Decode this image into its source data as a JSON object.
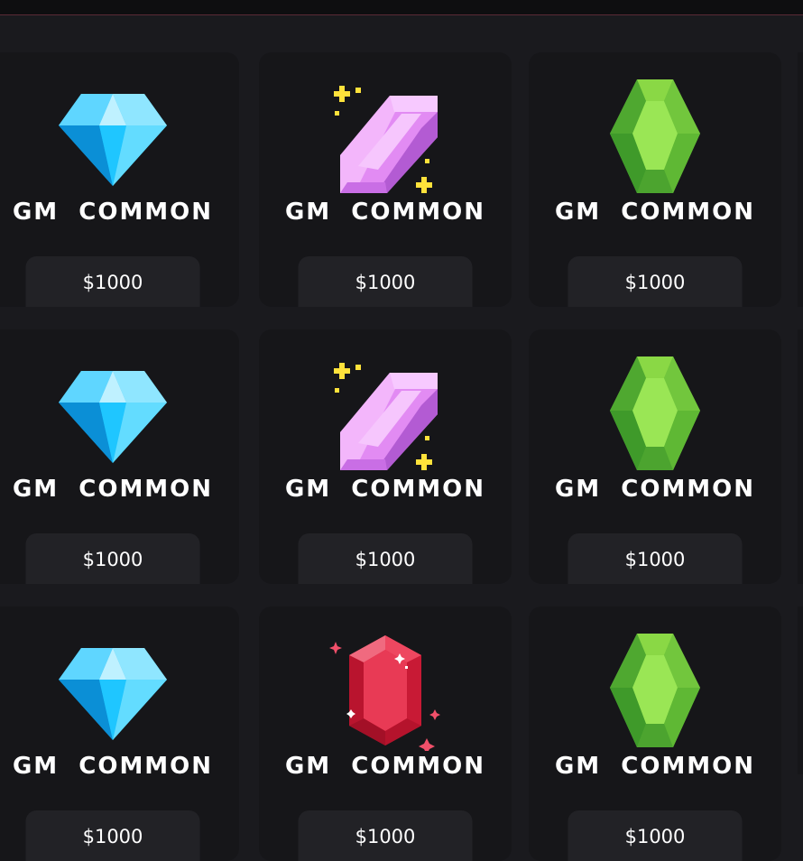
{
  "cards": [
    {
      "gem": "blue-diamond-icon",
      "title": "GM  COMMON",
      "price": "$1000"
    },
    {
      "gem": "purple-crystal-icon",
      "title": "GM  COMMON",
      "price": "$1000"
    },
    {
      "gem": "green-emerald-icon",
      "title": "GM  COMMON",
      "price": "$1000"
    },
    {
      "gem": "blue-diamond-icon",
      "title": "GM  COMMON",
      "price": "$1000"
    },
    {
      "gem": "purple-crystal-icon",
      "title": "GM  COMMON",
      "price": "$1000"
    },
    {
      "gem": "green-emerald-icon",
      "title": "GM  COMMON",
      "price": "$1000"
    },
    {
      "gem": "blue-diamond-icon",
      "title": "GM  COMMON",
      "price": "$1000"
    },
    {
      "gem": "red-ruby-icon",
      "title": "GM  COMMON",
      "price": "$1000"
    },
    {
      "gem": "green-emerald-icon",
      "title": "GM  COMMON",
      "price": "$1000"
    }
  ],
  "colors": {
    "background": "#1a1a1e",
    "card": "#161619",
    "price_pill": "#222226",
    "topbar_border": "#5a2a36"
  }
}
